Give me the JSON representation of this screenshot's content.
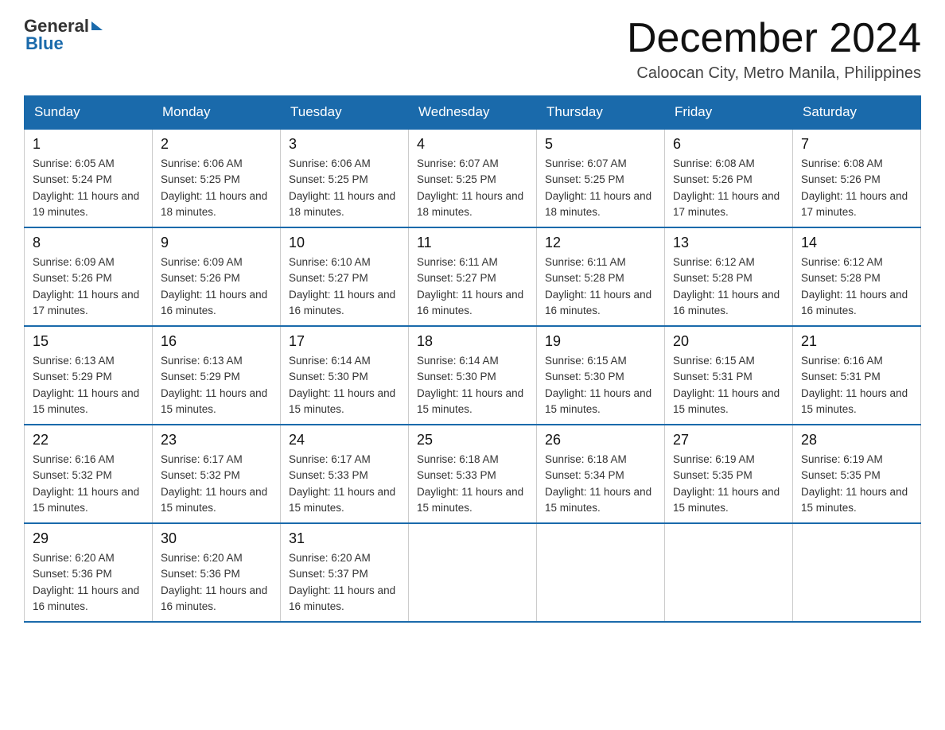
{
  "header": {
    "logo": {
      "general": "General",
      "blue": "Blue"
    },
    "title": "December 2024",
    "location": "Caloocan City, Metro Manila, Philippines"
  },
  "calendar": {
    "days_of_week": [
      "Sunday",
      "Monday",
      "Tuesday",
      "Wednesday",
      "Thursday",
      "Friday",
      "Saturday"
    ],
    "weeks": [
      [
        {
          "day": 1,
          "sunrise": "6:05 AM",
          "sunset": "5:24 PM",
          "daylight": "11 hours and 19 minutes."
        },
        {
          "day": 2,
          "sunrise": "6:06 AM",
          "sunset": "5:25 PM",
          "daylight": "11 hours and 18 minutes."
        },
        {
          "day": 3,
          "sunrise": "6:06 AM",
          "sunset": "5:25 PM",
          "daylight": "11 hours and 18 minutes."
        },
        {
          "day": 4,
          "sunrise": "6:07 AM",
          "sunset": "5:25 PM",
          "daylight": "11 hours and 18 minutes."
        },
        {
          "day": 5,
          "sunrise": "6:07 AM",
          "sunset": "5:25 PM",
          "daylight": "11 hours and 18 minutes."
        },
        {
          "day": 6,
          "sunrise": "6:08 AM",
          "sunset": "5:26 PM",
          "daylight": "11 hours and 17 minutes."
        },
        {
          "day": 7,
          "sunrise": "6:08 AM",
          "sunset": "5:26 PM",
          "daylight": "11 hours and 17 minutes."
        }
      ],
      [
        {
          "day": 8,
          "sunrise": "6:09 AM",
          "sunset": "5:26 PM",
          "daylight": "11 hours and 17 minutes."
        },
        {
          "day": 9,
          "sunrise": "6:09 AM",
          "sunset": "5:26 PM",
          "daylight": "11 hours and 16 minutes."
        },
        {
          "day": 10,
          "sunrise": "6:10 AM",
          "sunset": "5:27 PM",
          "daylight": "11 hours and 16 minutes."
        },
        {
          "day": 11,
          "sunrise": "6:11 AM",
          "sunset": "5:27 PM",
          "daylight": "11 hours and 16 minutes."
        },
        {
          "day": 12,
          "sunrise": "6:11 AM",
          "sunset": "5:28 PM",
          "daylight": "11 hours and 16 minutes."
        },
        {
          "day": 13,
          "sunrise": "6:12 AM",
          "sunset": "5:28 PM",
          "daylight": "11 hours and 16 minutes."
        },
        {
          "day": 14,
          "sunrise": "6:12 AM",
          "sunset": "5:28 PM",
          "daylight": "11 hours and 16 minutes."
        }
      ],
      [
        {
          "day": 15,
          "sunrise": "6:13 AM",
          "sunset": "5:29 PM",
          "daylight": "11 hours and 15 minutes."
        },
        {
          "day": 16,
          "sunrise": "6:13 AM",
          "sunset": "5:29 PM",
          "daylight": "11 hours and 15 minutes."
        },
        {
          "day": 17,
          "sunrise": "6:14 AM",
          "sunset": "5:30 PM",
          "daylight": "11 hours and 15 minutes."
        },
        {
          "day": 18,
          "sunrise": "6:14 AM",
          "sunset": "5:30 PM",
          "daylight": "11 hours and 15 minutes."
        },
        {
          "day": 19,
          "sunrise": "6:15 AM",
          "sunset": "5:30 PM",
          "daylight": "11 hours and 15 minutes."
        },
        {
          "day": 20,
          "sunrise": "6:15 AM",
          "sunset": "5:31 PM",
          "daylight": "11 hours and 15 minutes."
        },
        {
          "day": 21,
          "sunrise": "6:16 AM",
          "sunset": "5:31 PM",
          "daylight": "11 hours and 15 minutes."
        }
      ],
      [
        {
          "day": 22,
          "sunrise": "6:16 AM",
          "sunset": "5:32 PM",
          "daylight": "11 hours and 15 minutes."
        },
        {
          "day": 23,
          "sunrise": "6:17 AM",
          "sunset": "5:32 PM",
          "daylight": "11 hours and 15 minutes."
        },
        {
          "day": 24,
          "sunrise": "6:17 AM",
          "sunset": "5:33 PM",
          "daylight": "11 hours and 15 minutes."
        },
        {
          "day": 25,
          "sunrise": "6:18 AM",
          "sunset": "5:33 PM",
          "daylight": "11 hours and 15 minutes."
        },
        {
          "day": 26,
          "sunrise": "6:18 AM",
          "sunset": "5:34 PM",
          "daylight": "11 hours and 15 minutes."
        },
        {
          "day": 27,
          "sunrise": "6:19 AM",
          "sunset": "5:35 PM",
          "daylight": "11 hours and 15 minutes."
        },
        {
          "day": 28,
          "sunrise": "6:19 AM",
          "sunset": "5:35 PM",
          "daylight": "11 hours and 15 minutes."
        }
      ],
      [
        {
          "day": 29,
          "sunrise": "6:20 AM",
          "sunset": "5:36 PM",
          "daylight": "11 hours and 16 minutes."
        },
        {
          "day": 30,
          "sunrise": "6:20 AM",
          "sunset": "5:36 PM",
          "daylight": "11 hours and 16 minutes."
        },
        {
          "day": 31,
          "sunrise": "6:20 AM",
          "sunset": "5:37 PM",
          "daylight": "11 hours and 16 minutes."
        },
        null,
        null,
        null,
        null
      ]
    ]
  }
}
